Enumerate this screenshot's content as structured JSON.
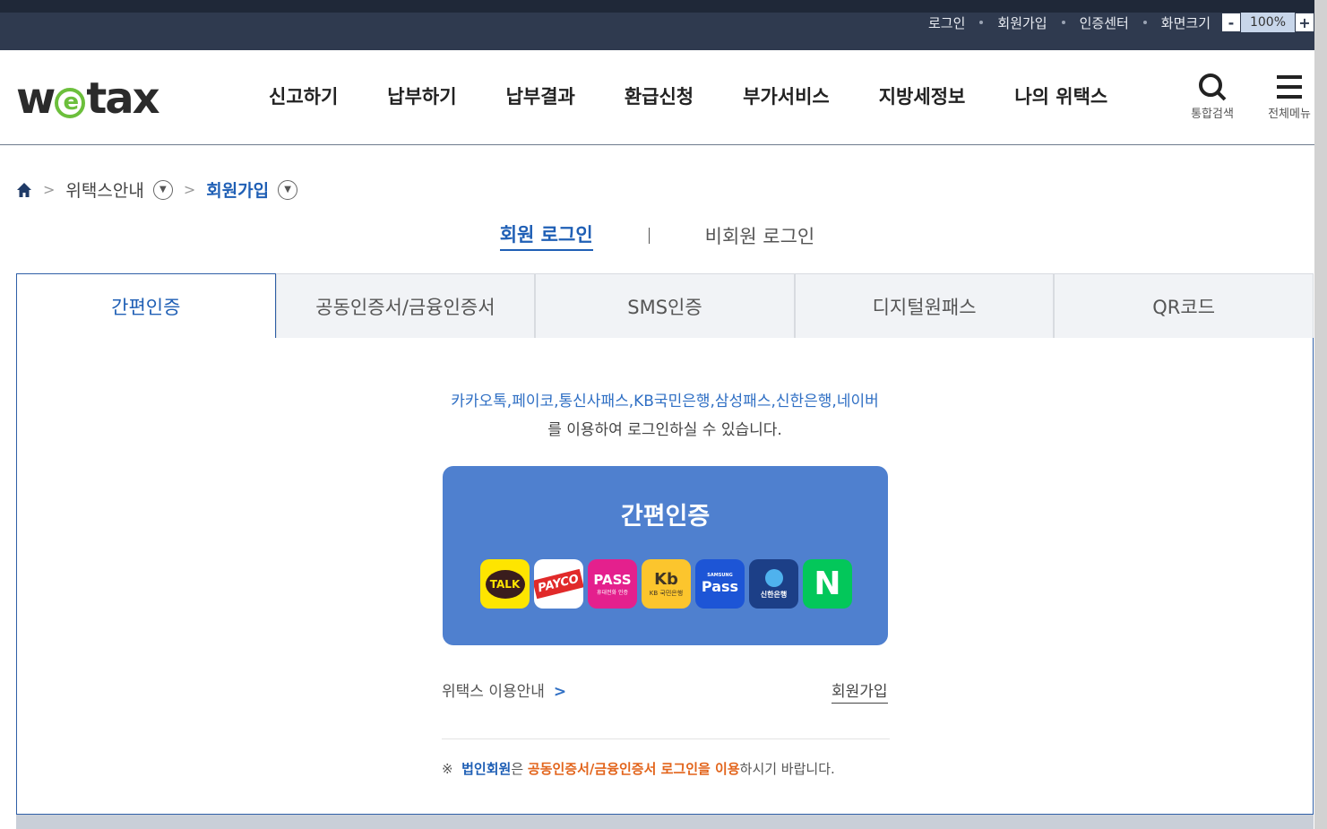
{
  "top_links": [
    "로그인",
    "회원가입",
    "인증센터",
    "화면크기"
  ],
  "zoom": {
    "minus": "-",
    "value": "100%",
    "plus": "+"
  },
  "logo": {
    "before": "w",
    "circle": "e",
    "after": "tax"
  },
  "gnb": [
    "신고하기",
    "납부하기",
    "납부결과",
    "환급신청",
    "부가서비스",
    "지방세정보",
    "나의 위택스"
  ],
  "tools": {
    "search": "통합검색",
    "menu": "전체메뉴"
  },
  "breadcrumb": {
    "level1": "위택스안내",
    "current": "회원가입"
  },
  "login_tabs": {
    "member": "회원 로그인",
    "non_member": "비회원 로그인"
  },
  "auth_tabs": [
    "간편인증",
    "공동인증서/금융인증서",
    "SMS인증",
    "디지털원패스",
    "QR코드"
  ],
  "description": {
    "providers_line": "카카오톡,페이코,통신사패스,KB국민은행,삼성패스,신한은행,네이버",
    "suffix_line": "를 이용하여 로그인하실 수 있습니다."
  },
  "simple_box": {
    "title": "간편인증",
    "providers": [
      {
        "name": "kakao",
        "text": "TALK"
      },
      {
        "name": "payco",
        "text": "PAYCO"
      },
      {
        "name": "pass",
        "text": "PASS",
        "sub": "휴대전화 인증"
      },
      {
        "name": "kb",
        "text": "Kb",
        "sub": "KB 국민은행"
      },
      {
        "name": "samsung-pass",
        "text": "Pass",
        "sub": "SAMSUNG"
      },
      {
        "name": "shinhan",
        "text": "신한은행"
      },
      {
        "name": "naver",
        "text": "N"
      }
    ]
  },
  "links": {
    "guide": "위택스 이용안내",
    "join": "회원가입"
  },
  "notice": {
    "mark": "※",
    "corp": "법인회원",
    "mid": "은 ",
    "cert": "공동인증서/금융인증서 로그인을 이용",
    "tail": "하시기 바랍니다."
  },
  "colors": {
    "accent": "#1f5fb5",
    "box": "#4f80cf",
    "topbar": "#2f3a4f"
  }
}
